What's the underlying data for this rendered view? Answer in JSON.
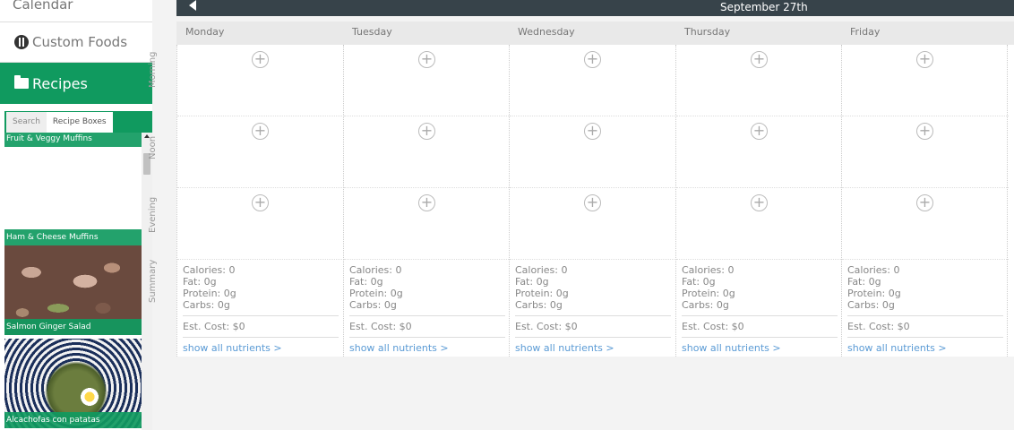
{
  "sidebar": {
    "items": [
      {
        "label": "Calendar"
      },
      {
        "label": "Custom Foods",
        "icon": "fork-knife-icon"
      },
      {
        "label": "Recipes",
        "icon": "folder-icon"
      }
    ],
    "recipe_tabs": [
      "Search",
      "Recipe Boxes"
    ],
    "recipes": [
      {
        "name": "Fruit & Veggy Muffins"
      },
      {
        "name": "Ham & Cheese Muffins"
      },
      {
        "name": "Salmon Ginger Salad"
      },
      {
        "name": "Alcachofas con patatas"
      }
    ]
  },
  "header": {
    "date": "September 27th"
  },
  "days": [
    "Monday",
    "Tuesday",
    "Wednesday",
    "Thursday",
    "Friday"
  ],
  "rows": [
    "Morning",
    "Noon",
    "Evening",
    "Summary"
  ],
  "summary": {
    "calories": "Calories: 0",
    "fat": "Fat: 0g",
    "protein": "Protein: 0g",
    "carbs": "Carbs: 0g",
    "cost": "Est. Cost: $0",
    "link": "show all nutrients >"
  },
  "add_symbol": "+",
  "colors": {
    "accent": "#109a5f",
    "header": "#37434a",
    "link": "#5b9bd5"
  }
}
